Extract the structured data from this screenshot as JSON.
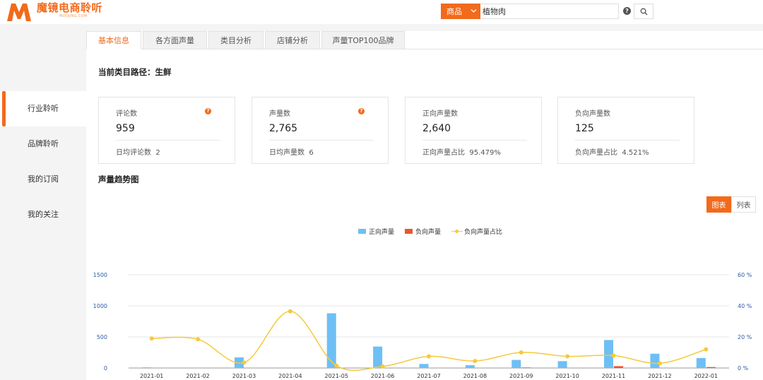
{
  "brand": {
    "name": "魔镜电商聆听",
    "sub": "MOOJING.COM",
    "colors": {
      "accent": "#f26a1b"
    }
  },
  "search": {
    "category": "商品",
    "query": "植物肉",
    "help_icon": "question-circle-icon",
    "search_icon": "magnifier-icon"
  },
  "tabs": [
    {
      "label": "基本信息",
      "active": true
    },
    {
      "label": "各方面声量",
      "active": false
    },
    {
      "label": "类目分析",
      "active": false
    },
    {
      "label": "店铺分析",
      "active": false
    },
    {
      "label": "声量TOP100品牌",
      "active": false
    }
  ],
  "sidebar": {
    "items": [
      {
        "label": "行业聆听",
        "active": true
      },
      {
        "label": "品牌聆听",
        "active": false
      },
      {
        "label": "我的订阅",
        "active": false
      },
      {
        "label": "我的关注",
        "active": false
      }
    ]
  },
  "category_path": "当前类目路径：生鲜",
  "cards": [
    {
      "title": "评论数",
      "value": "959",
      "sub_label": "日均评论数",
      "sub_value": "2",
      "help": true
    },
    {
      "title": "声量数",
      "value": "2,765",
      "sub_label": "日均声量数",
      "sub_value": "6",
      "help": true
    },
    {
      "title": "正向声量数",
      "value": "2,640",
      "sub_label": "正向声量占比",
      "sub_value": "95.479%",
      "help": false
    },
    {
      "title": "负向声量数",
      "value": "125",
      "sub_label": "负向声量占比",
      "sub_value": "4.521%",
      "help": false
    }
  ],
  "trend_title": "声量趋势图",
  "view_toggle": {
    "chart": "图表",
    "list": "列表"
  },
  "chart_data": {
    "type": "bar",
    "categories": [
      "2021-01",
      "2021-02",
      "2021-03",
      "2021-04",
      "2021-05",
      "2021-06",
      "2021-07",
      "2021-08",
      "2021-09",
      "2021-10",
      "2021-11",
      "2021-12",
      "2022-01"
    ],
    "series": [
      {
        "name": "正向声量",
        "type": "bar",
        "color": "#6ebff5",
        "values": [
          10,
          0,
          170,
          0,
          880,
          345,
          65,
          45,
          130,
          110,
          450,
          230,
          160
        ]
      },
      {
        "name": "负向声量",
        "type": "bar",
        "color": "#e8572f",
        "values": [
          0,
          0,
          0,
          0,
          0,
          0,
          0,
          0,
          8,
          0,
          30,
          0,
          15
        ]
      },
      {
        "name": "负向声量占比",
        "type": "line",
        "color": "#f6c93c",
        "axis": "right",
        "values": [
          19,
          18.5,
          3.5,
          36.5,
          1.5,
          1,
          7.5,
          4.5,
          10,
          7.5,
          8,
          3,
          12
        ]
      }
    ],
    "y_left": {
      "ticks": [
        0,
        500,
        1000,
        1500
      ],
      "ylim": [
        0,
        1500
      ]
    },
    "y_right": {
      "ticks": [
        "0 %",
        "20 %",
        "40 %",
        "60 %"
      ],
      "ylim": [
        0,
        60
      ]
    },
    "grid": true,
    "legend_position": "top-center"
  }
}
